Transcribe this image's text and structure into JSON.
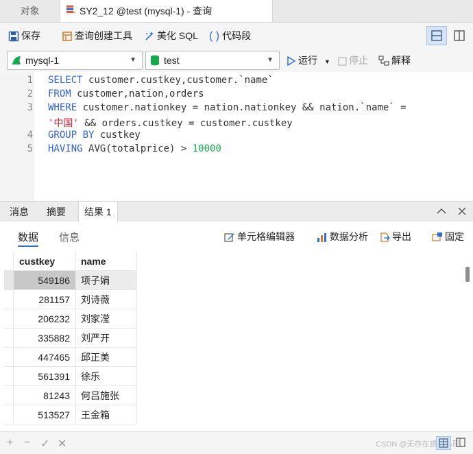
{
  "tabs": {
    "objects": "对象",
    "query": "SY2_12 @test (mysql-1) - 查询"
  },
  "toolbar": {
    "save": "保存",
    "query_builder": "查询创建工具",
    "beautify": "美化 SQL",
    "snippet": "代码段"
  },
  "connection": {
    "server": "mysql-1",
    "database": "test",
    "run": "运行",
    "stop": "停止",
    "explain": "解释"
  },
  "editor": {
    "line_numbers": [
      "1",
      "2",
      "3",
      "",
      "4",
      "5"
    ],
    "lines": [
      [
        {
          "t": "SELECT ",
          "c": "kw"
        },
        {
          "t": "customer.custkey,customer.`name`",
          "c": "id"
        }
      ],
      [
        {
          "t": "FROM ",
          "c": "kw"
        },
        {
          "t": "customer,nation,orders",
          "c": "id"
        }
      ],
      [
        {
          "t": "WHERE ",
          "c": "kw"
        },
        {
          "t": "customer.nationkey = nation.nationkey && nation.`name` =",
          "c": "id"
        }
      ],
      [
        {
          "t": "'中国'",
          "c": "str"
        },
        {
          "t": " && orders.custkey = customer.custkey",
          "c": "id"
        }
      ],
      [
        {
          "t": "GROUP BY ",
          "c": "kw"
        },
        {
          "t": "custkey",
          "c": "id"
        }
      ],
      [
        {
          "t": "HAVING ",
          "c": "kw"
        },
        {
          "t": "AVG(totalprice) > ",
          "c": "id"
        },
        {
          "t": "10000",
          "c": "num"
        }
      ]
    ]
  },
  "panel_tabs": [
    "消息",
    "摘要",
    "结果 1"
  ],
  "subtabs": {
    "data": "数据",
    "info": "信息"
  },
  "result_actions": {
    "cell_editor": "单元格编辑器",
    "data_analysis": "数据分析",
    "export": "导出",
    "pin": "固定"
  },
  "grid": {
    "columns": [
      "custkey",
      "name"
    ],
    "rows": [
      [
        "549186",
        "项子娟"
      ],
      [
        "281157",
        "刘诗薇"
      ],
      [
        "206232",
        "刘家滢"
      ],
      [
        "335882",
        "刘严开"
      ],
      [
        "447465",
        "邱正美"
      ],
      [
        "561391",
        "徐乐"
      ],
      [
        "81243",
        "何吕施张"
      ],
      [
        "513527",
        "王金箱"
      ]
    ]
  },
  "statusbar": {
    "icons": [
      "+",
      "−",
      "✓",
      "✕"
    ],
    "watermark": "CSDN @无存在感的小昆"
  },
  "colors": {
    "keyword": "#2d5fe0",
    "string": "#d0243d",
    "number": "#18a94b",
    "accent": "#2d6fd3"
  }
}
